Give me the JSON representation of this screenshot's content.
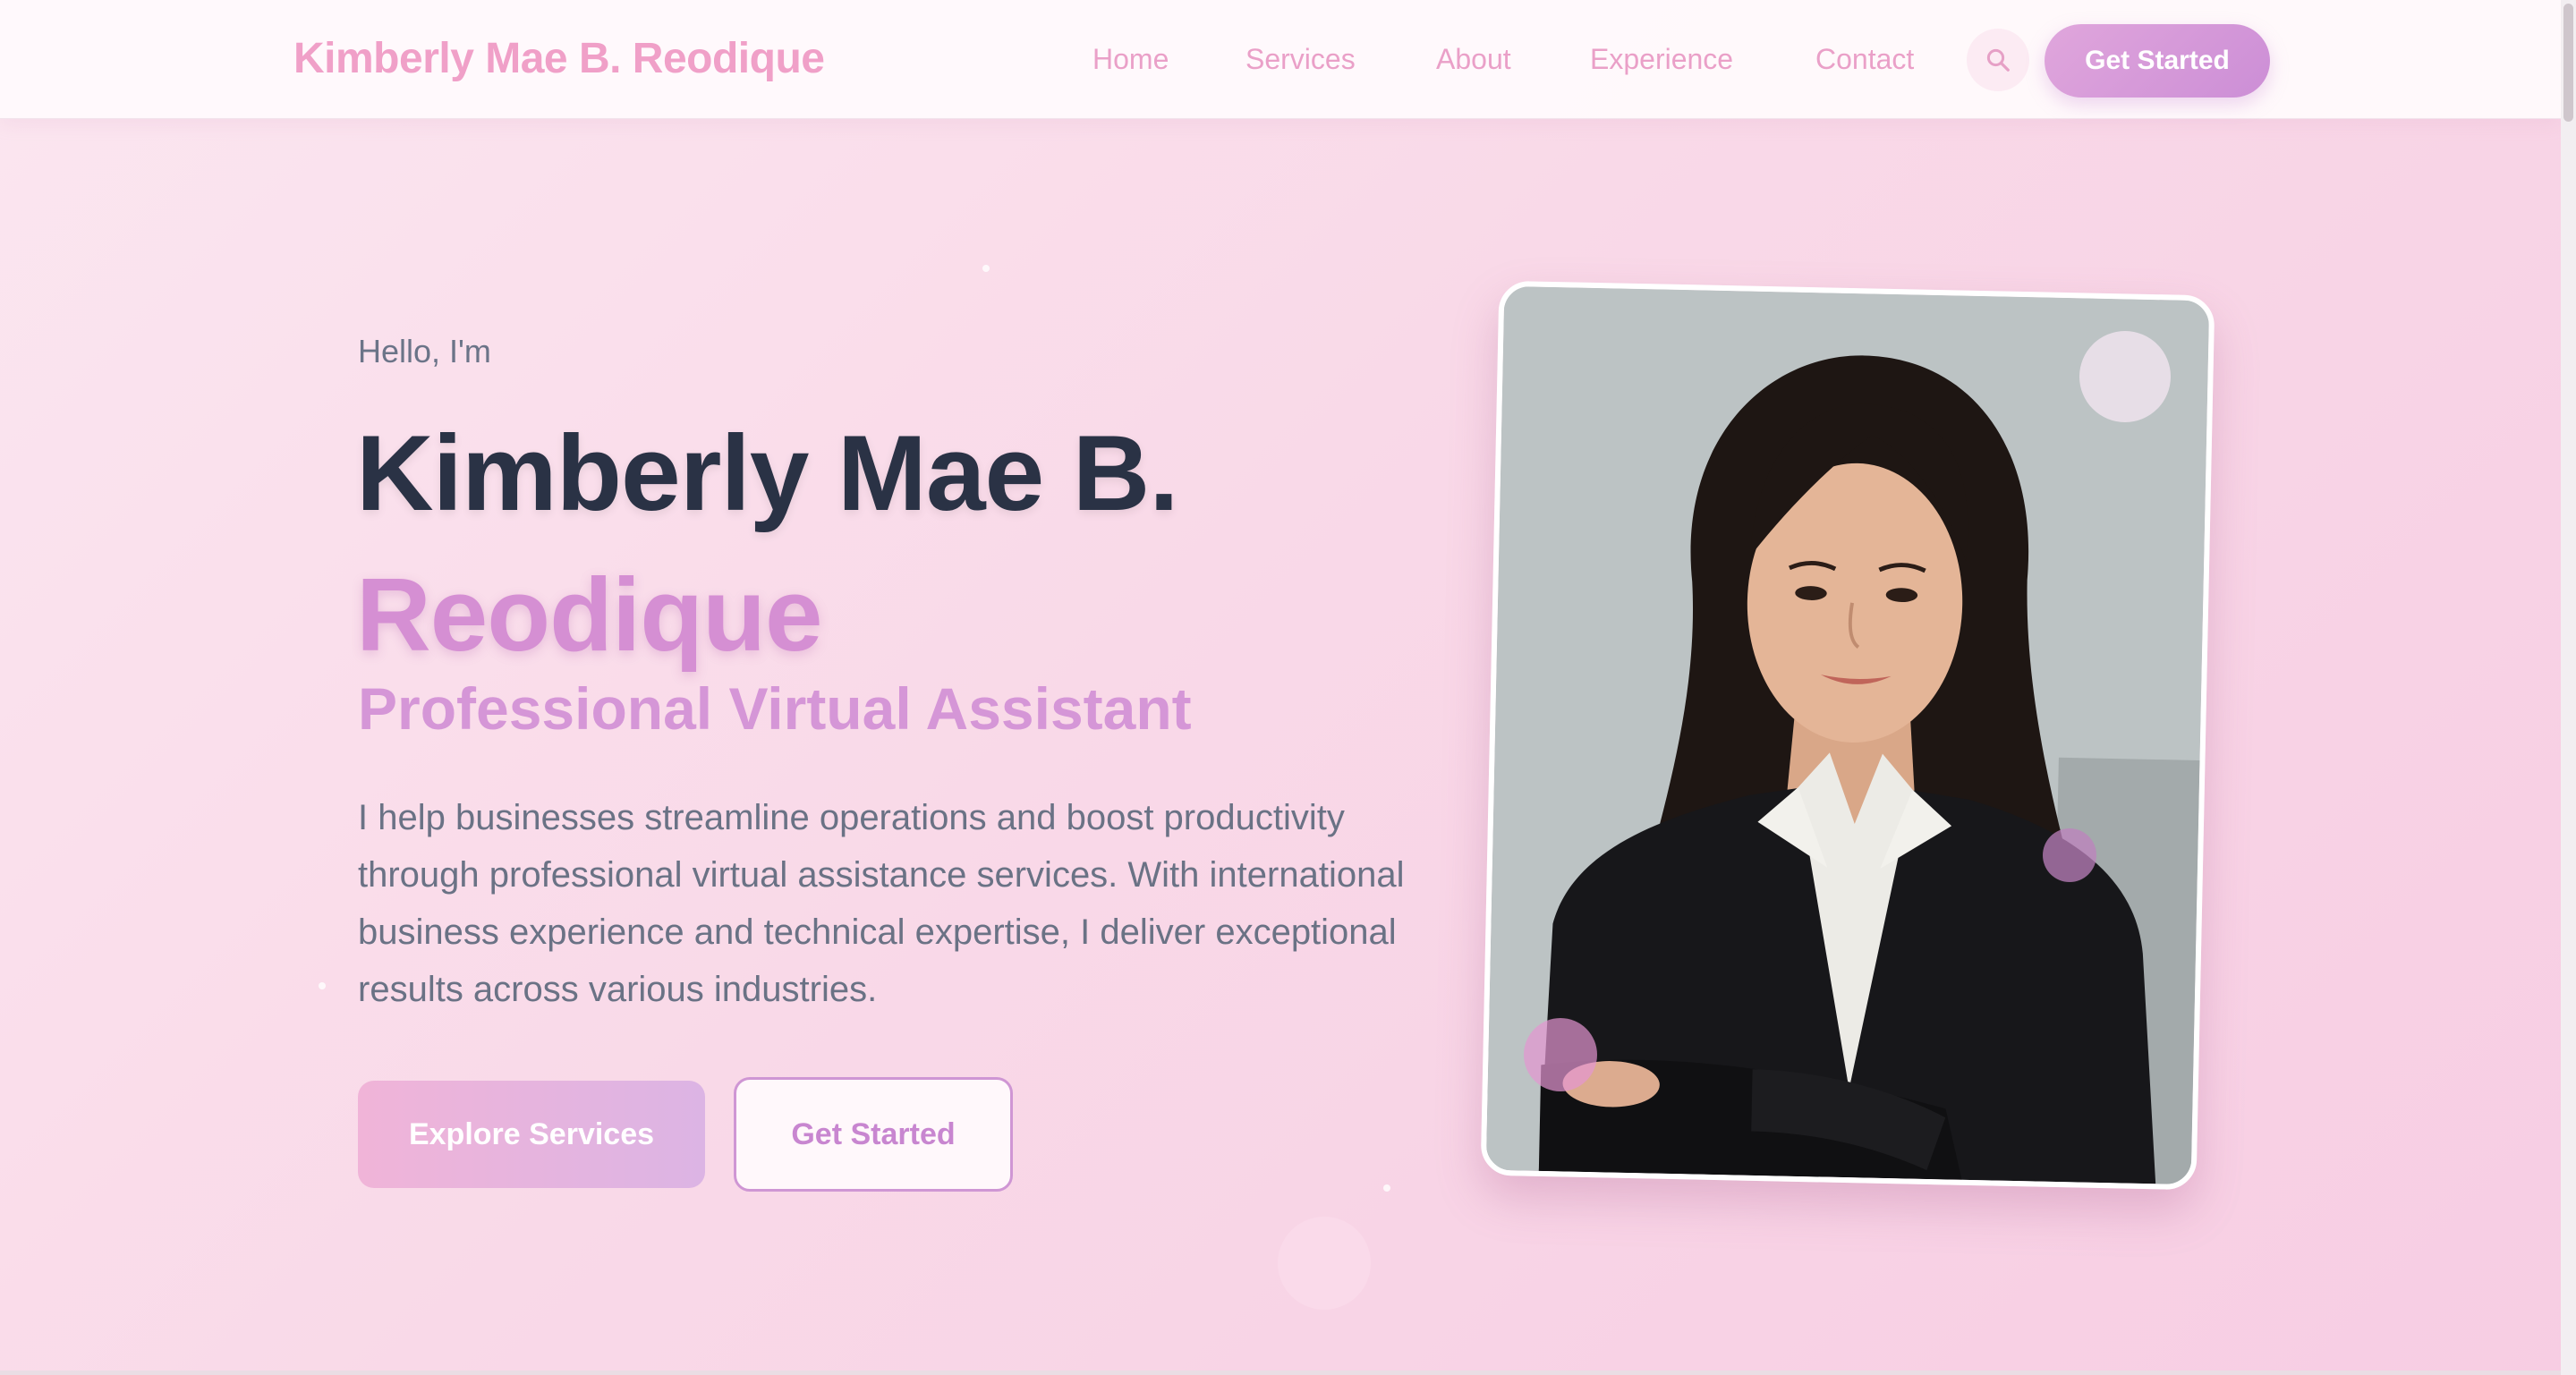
{
  "nav": {
    "brand": "Kimberly Mae B. Reodique",
    "links": [
      "Home",
      "Services",
      "About",
      "Experience",
      "Contact"
    ],
    "search_icon": "search-icon",
    "cta": "Get Started"
  },
  "hero": {
    "greeting": "Hello, I'm",
    "name_line1": "Kimberly Mae B.",
    "name_line2": "Reodique",
    "role": "Professional Virtual Assistant",
    "intro": "I help businesses streamline operations and boost productivity through professional virtual assistance services. With international business experience and technical expertise, I deliver exceptional results across various industries.",
    "primary_button": "Explore Services",
    "secondary_button": "Get Started"
  },
  "colors": {
    "accent": "#d58fd3",
    "brand_pink": "#f0a0c8",
    "heading": "#2a3245",
    "body_text": "#6a7285",
    "background": "#f9d9e8"
  }
}
